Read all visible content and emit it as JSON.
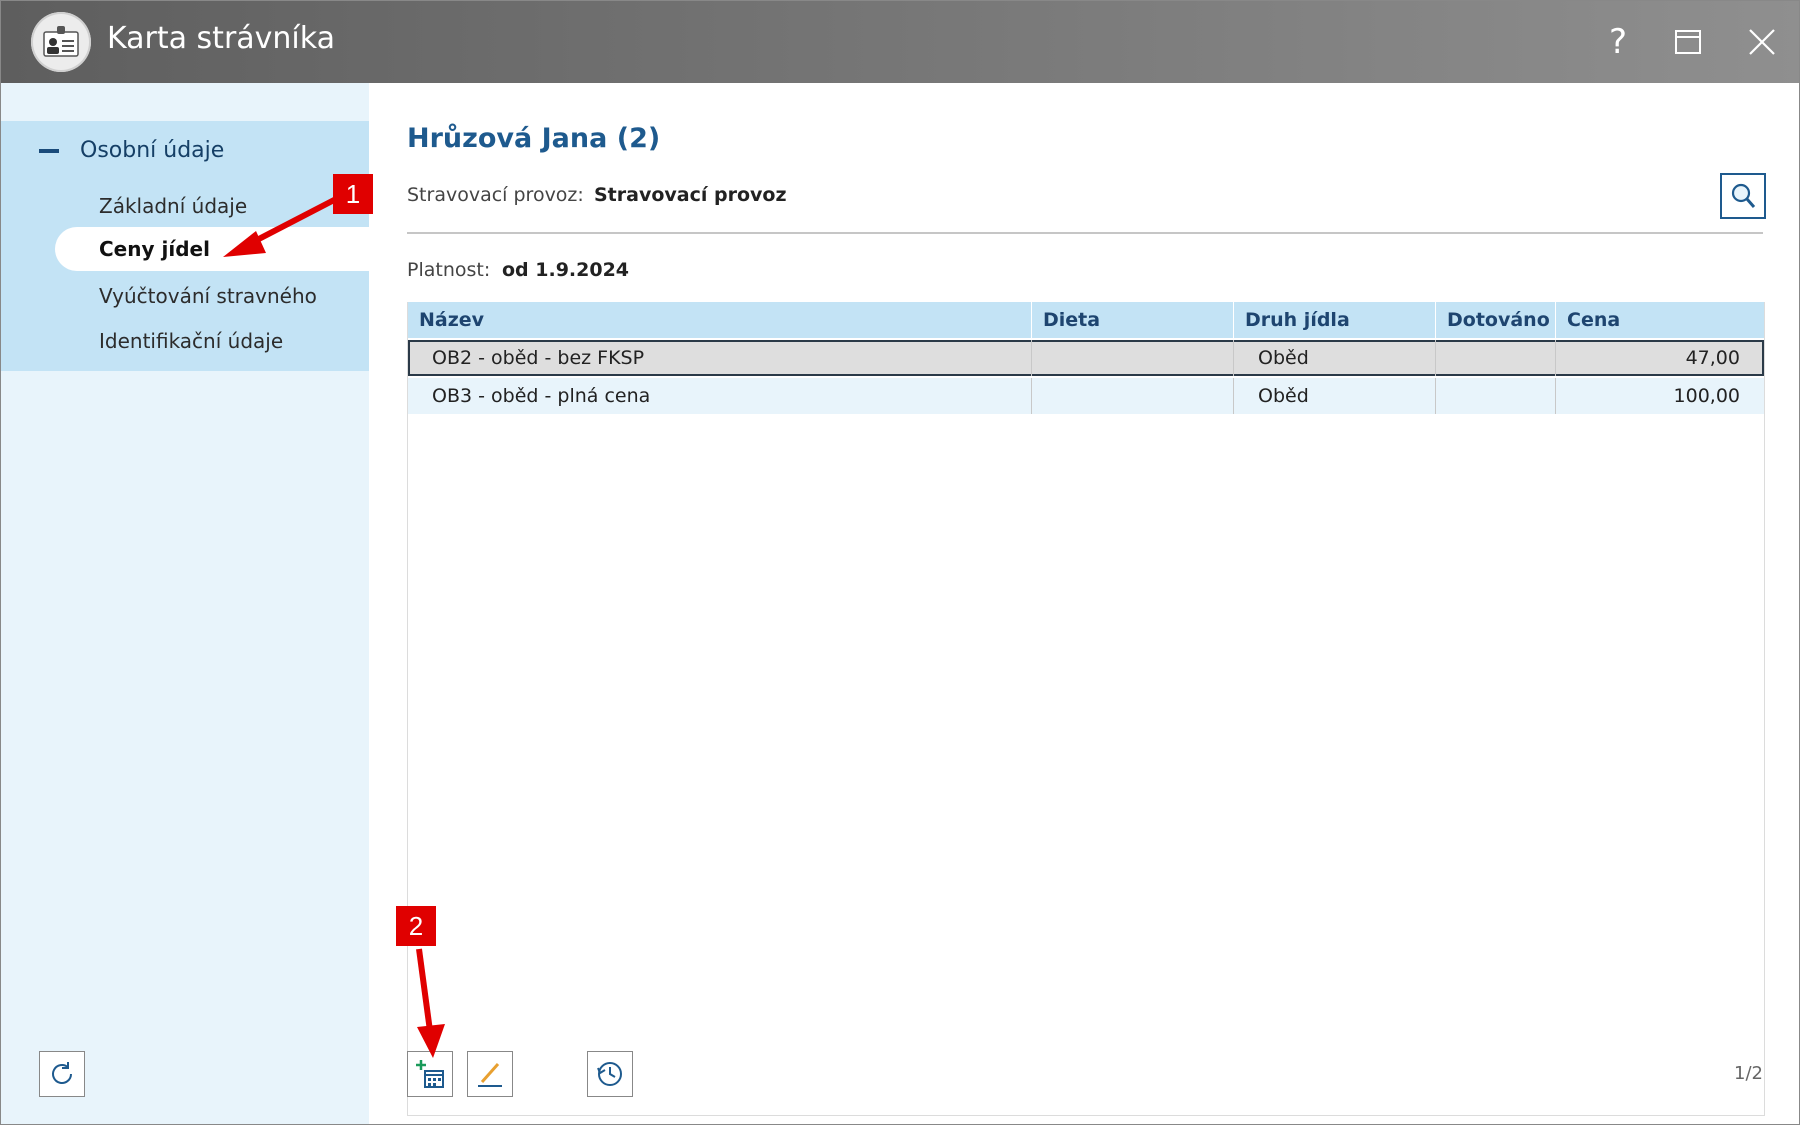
{
  "window": {
    "title": "Karta strávníka"
  },
  "titlebar": {
    "help": "?"
  },
  "sidebar": {
    "group_title": "Osobní údaje",
    "items": [
      {
        "label": "Základní údaje"
      },
      {
        "label": "Ceny jídel"
      },
      {
        "label": "Vyúčtování stravného"
      },
      {
        "label": "Identifikační údaje"
      }
    ]
  },
  "main": {
    "heading": "Hrůzová Jana (2)",
    "provoz_label": "Stravovací provoz:",
    "provoz_value": "Stravovací provoz",
    "platnost_label": "Platnost:",
    "platnost_value": "od 1.9.2024",
    "table": {
      "headers": [
        "Název",
        "Dieta",
        "Druh jídla",
        "Dotováno",
        "Cena"
      ],
      "rows": [
        {
          "nazev": "OB2 - oběd - bez FKSP",
          "dieta": "",
          "druh": "Oběd",
          "dotovano": "",
          "cena": "47,00"
        },
        {
          "nazev": "OB3 - oběd - plná cena",
          "dieta": "",
          "druh": "Oběd",
          "dotovano": "",
          "cena": "100,00"
        }
      ]
    },
    "pager": "1/2"
  },
  "annotations": {
    "badge1": "1",
    "badge2": "2"
  },
  "colors": {
    "accent": "#1e5a8e",
    "sidebar_bg": "#e8f4fb",
    "header_bg": "#c3e3f5",
    "annotation": "#e00000"
  }
}
